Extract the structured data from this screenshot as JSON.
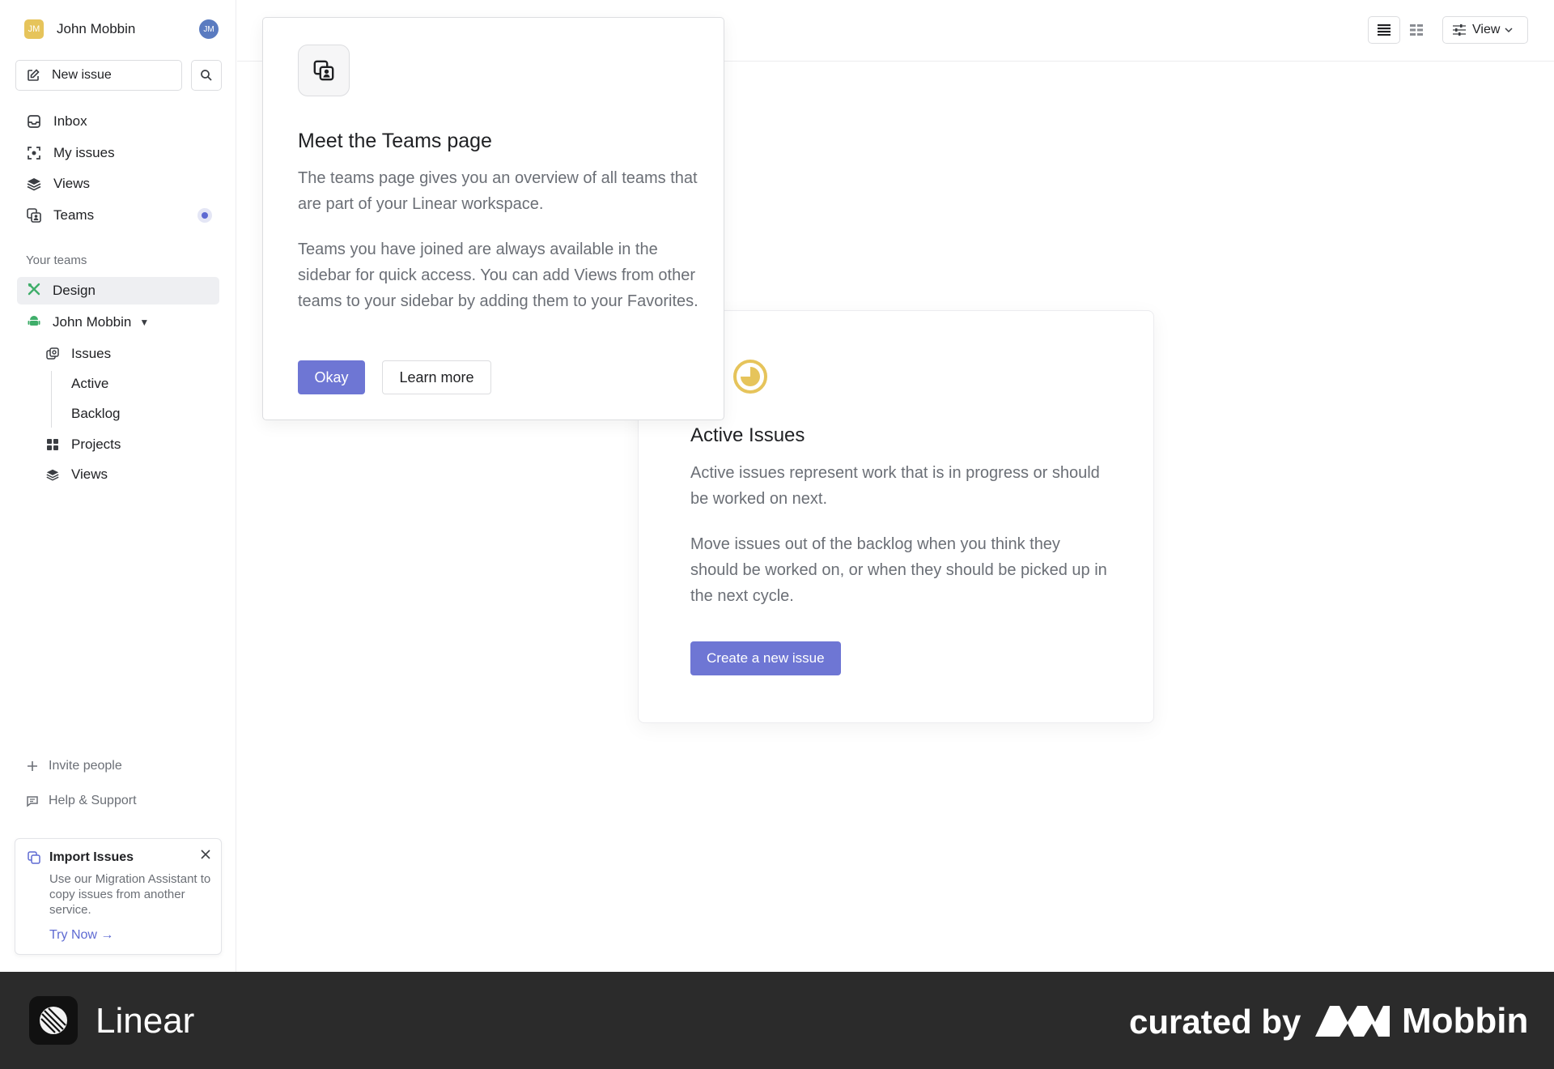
{
  "workspace": {
    "name": "John Mobbin",
    "initials": "JM",
    "avatar_initials": "JM"
  },
  "sidebar": {
    "new_issue": "New issue",
    "nav": [
      {
        "label": "Inbox",
        "icon": "inbox-icon"
      },
      {
        "label": "My issues",
        "icon": "target-icon"
      },
      {
        "label": "Views",
        "icon": "layers-icon"
      },
      {
        "label": "Teams",
        "icon": "teams-icon"
      }
    ],
    "section_label": "Your teams",
    "teams": [
      {
        "label": "Design",
        "icon": "design-tools-icon"
      },
      {
        "label": "John Mobbin",
        "icon": "android-icon"
      }
    ],
    "team_items": [
      {
        "label": "Issues",
        "icon": "issues-icon"
      },
      {
        "label": "Active"
      },
      {
        "label": "Backlog"
      },
      {
        "label": "Projects",
        "icon": "grid-icon"
      },
      {
        "label": "Views",
        "icon": "layers-icon"
      }
    ],
    "invite": "Invite people",
    "help": "Help & Support",
    "import_card": {
      "title": "Import Issues",
      "desc": "Use our Migration Assistant to copy issues from another service.",
      "link": "Try Now →"
    }
  },
  "topbar": {
    "view_label": "View"
  },
  "active_card": {
    "title": "Active Issues",
    "p1": "Active issues represent work that is in progress or should be worked on next.",
    "p2": "Move issues out of the backlog when you think they should be worked on, or when they should be picked up in the next cycle.",
    "button": "Create a new issue"
  },
  "popover": {
    "title": "Meet the Teams page",
    "p1": "The teams page gives you an overview of all teams that are part of your Linear workspace.",
    "p2": "Teams you have joined are always available in the sidebar for quick access. You can add Views from other teams to your sidebar by adding them to your Favorites.",
    "okay": "Okay",
    "learn_more": "Learn more"
  },
  "banner": {
    "app_name": "Linear",
    "curated_by": "curated by",
    "mobbin": "Mobbin"
  },
  "colors": {
    "accent": "#6e76d4",
    "banner_bg": "#2b2b2b",
    "active_icon": "#e6c45b"
  }
}
